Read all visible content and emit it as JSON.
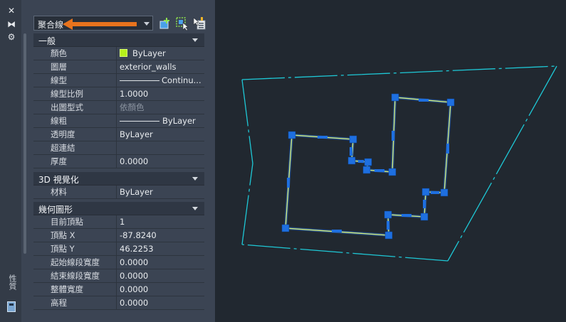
{
  "object_type_select": {
    "value": "聚合線"
  },
  "toolbar": {
    "toggle_pickadd": "toggle-pickadd-icon",
    "select_objects": "select-objects-icon",
    "quick_select": "quick-select-icon"
  },
  "palette_title": "性質",
  "sections": {
    "general": {
      "title": "一般",
      "rows": [
        {
          "label": "顏色",
          "value": "ByLayer"
        },
        {
          "label": "圖層",
          "value": "exterior_walls"
        },
        {
          "label": "線型",
          "value": "Continu..."
        },
        {
          "label": "線型比例",
          "value": "1.0000"
        },
        {
          "label": "出圖型式",
          "value": "依顏色"
        },
        {
          "label": "線粗",
          "value": "ByLayer"
        },
        {
          "label": "透明度",
          "value": "ByLayer"
        },
        {
          "label": "超連結",
          "value": ""
        },
        {
          "label": "厚度",
          "value": "0.0000"
        }
      ]
    },
    "visual3d": {
      "title": "3D 視覺化",
      "rows": [
        {
          "label": "材料",
          "value": "ByLayer"
        }
      ]
    },
    "geometry": {
      "title": "幾何圖形",
      "rows": [
        {
          "label": "目前頂點",
          "value": "1"
        },
        {
          "label": "頂點 X",
          "value": "-87.8240"
        },
        {
          "label": "頂點 Y",
          "value": "46.2253"
        },
        {
          "label": "起始線段寬度",
          "value": "0.0000"
        },
        {
          "label": "結束線段寬度",
          "value": "0.0000"
        },
        {
          "label": "整體寬度",
          "value": "0.0000"
        },
        {
          "label": "高程",
          "value": "0.0000"
        }
      ]
    }
  },
  "colors": {
    "accent_arrow": "#e8731d",
    "polyline": "#d9f27a",
    "grip": "#1e6fe0",
    "boundary": "#1ec8d6",
    "swatch": "#b7f21a"
  }
}
